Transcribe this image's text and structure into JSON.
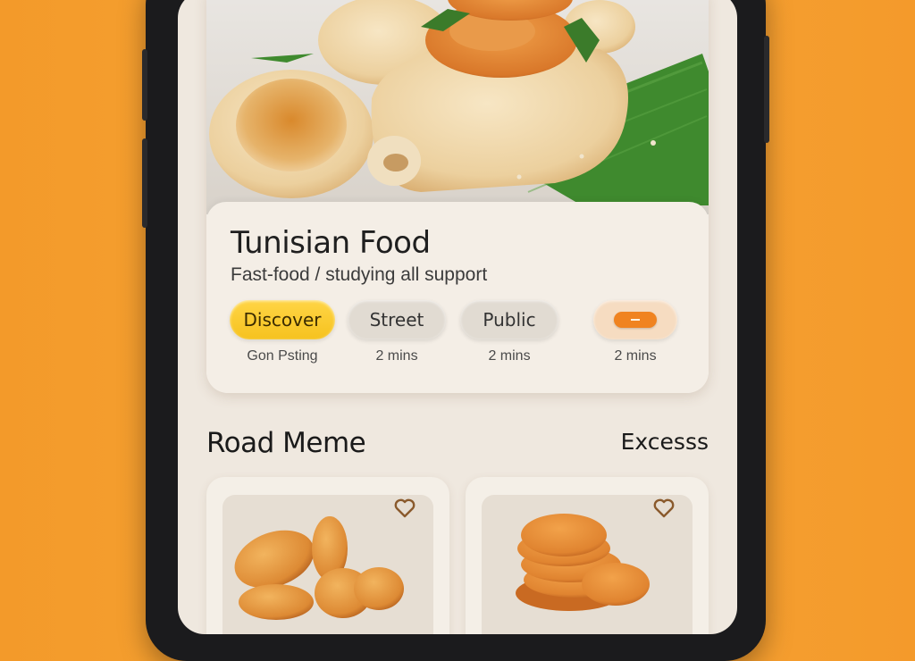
{
  "hero": {
    "title": "Tunisian Food",
    "subtitle": "Fast-food / studying all support"
  },
  "chips": [
    {
      "label": "Discover",
      "meta": "Gon Psting",
      "active": true
    },
    {
      "label": "Street",
      "meta": "2 mins",
      "active": false
    },
    {
      "label": "Public",
      "meta": "2 mins",
      "active": false
    },
    {
      "label": "",
      "meta": "2 mins",
      "icon": "toggle-icon",
      "active": false
    }
  ],
  "section": {
    "title": "Road Meme",
    "link": "Excesss"
  },
  "items": [
    {
      "icon": "heart-icon"
    },
    {
      "icon": "heart-icon"
    }
  ],
  "colors": {
    "background": "#f7a637",
    "accent_yellow": "#f6c21e",
    "accent_orange": "#f08320",
    "card": "#f4eee6"
  }
}
